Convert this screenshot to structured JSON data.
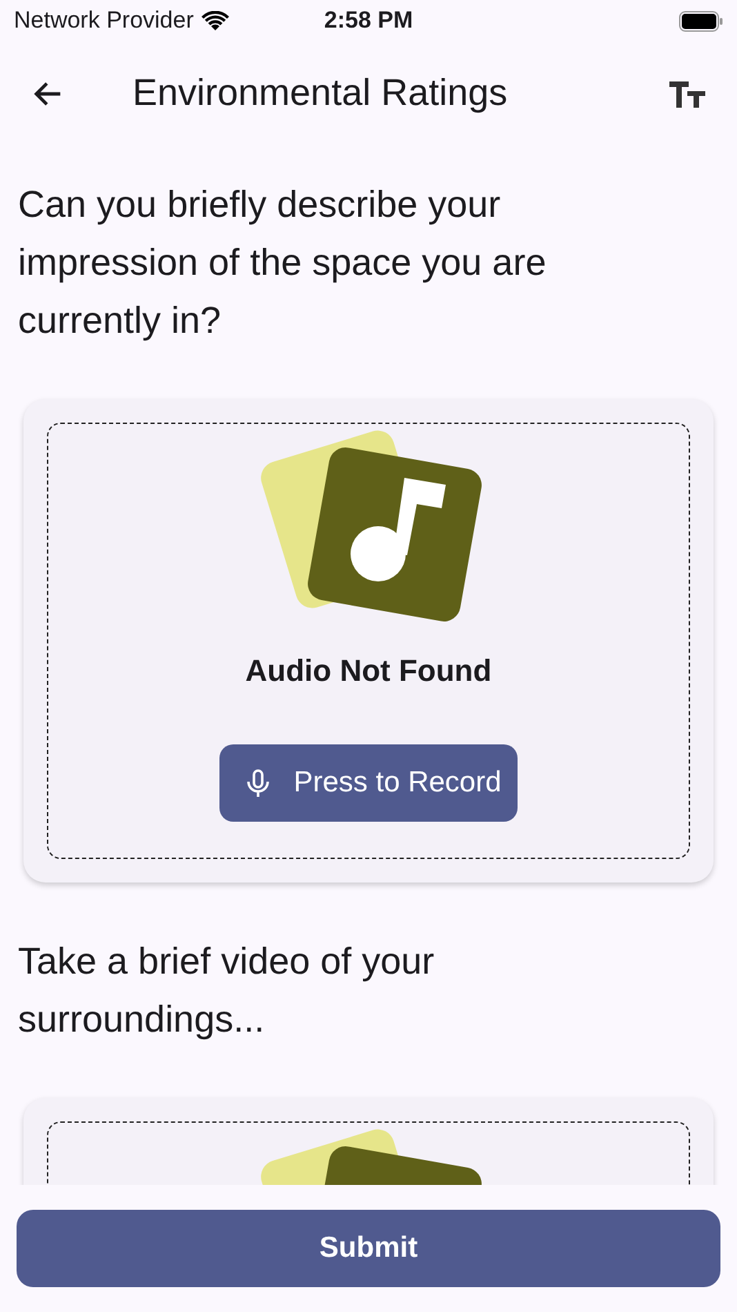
{
  "status_bar": {
    "carrier": "Network Provider",
    "time": "2:58 PM"
  },
  "app_bar": {
    "title": "Environmental Ratings"
  },
  "sections": [
    {
      "kind": "audio",
      "question": "Can you briefly describe your impression of the space you are currently in?",
      "status": "Audio Not Found",
      "button": "Press to Record"
    },
    {
      "kind": "video",
      "question": "Take a brief video of your surroundings..."
    }
  ],
  "submit": "Submit"
}
